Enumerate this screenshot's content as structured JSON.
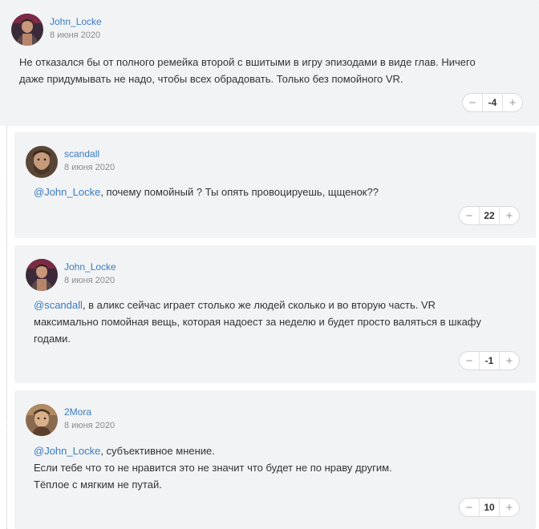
{
  "comments": [
    {
      "author": "John_Locke",
      "date": "8 июня 2020",
      "lines": [
        "Не отказался бы от полного ремейка второй с вшитыми в игру эпизодами в виде глав. Ничего",
        "даже придумывать не надо, чтобы всех обрадовать. Только без помойного VR."
      ],
      "score": "-4",
      "avatar_icon": "user-avatar-man-icon"
    },
    {
      "author": "scandall",
      "date": "8 июня 2020",
      "mention": "@John_Locke",
      "lines": [
        ", почему помойный ? Ты опять провоцируешь, щщенок??"
      ],
      "score": "22",
      "avatar_icon": "user-avatar-bearded-icon"
    },
    {
      "author": "John_Locke",
      "date": "8 июня 2020",
      "mention": "@scandall",
      "lines": [
        ", в аликс сейчас играет столько же людей сколько и во вторую часть. VR",
        "максимально помойная вещь, которая надоест за неделю и будет просто валяться в шкафу",
        "годами."
      ],
      "score": "-1",
      "avatar_icon": "user-avatar-man-icon"
    },
    {
      "author": "2Mora",
      "date": "8 июня 2020",
      "mention": "@John_Locke",
      "lines": [
        ", субъективное мнение.",
        "Если тебе что то не нравится это не значит что будет не по нраву другим.",
        "Тёплое с мягким не путай."
      ],
      "score": "10",
      "avatar_icon": "user-avatar-character-icon"
    }
  ],
  "vote_controls": {
    "minus": "−",
    "plus": "+"
  },
  "colors": {
    "link": "#3a7bbf",
    "card": "#f2f3f5"
  }
}
